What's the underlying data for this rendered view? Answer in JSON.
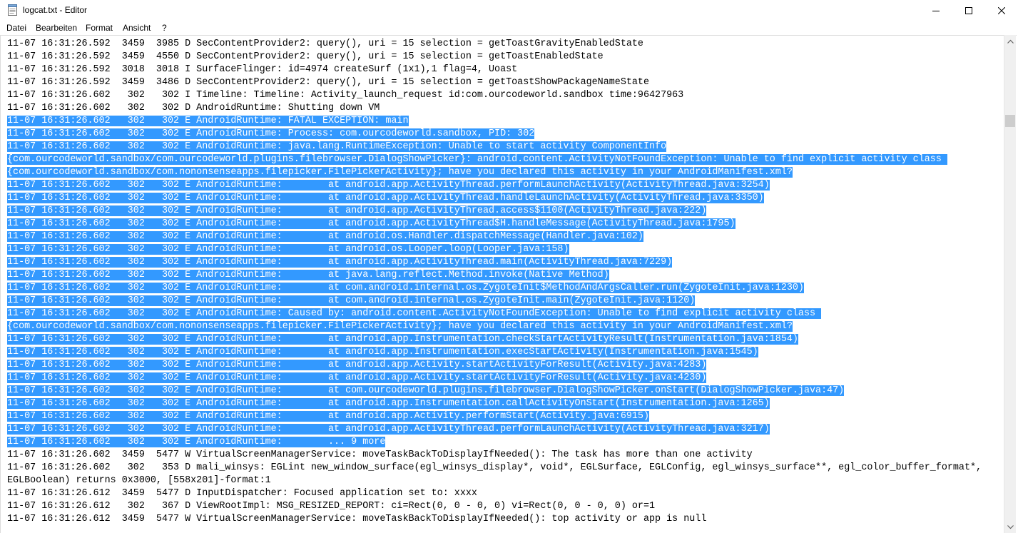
{
  "window": {
    "title": "logcat.txt - Editor",
    "controls": {
      "minimize": "minimize",
      "maximize": "maximize",
      "close": "close"
    }
  },
  "menu": [
    "Datei",
    "Bearbeiten",
    "Format",
    "Ansicht",
    "?"
  ],
  "colors": {
    "selection": "#3399ff",
    "selection_text": "#ffffff",
    "text": "#000000"
  },
  "lines": [
    {
      "text": "11-07 16:31:26.592  3459  3985 D SecContentProvider2: query(), uri = 15 selection = getToastGravityEnabledState",
      "selected": false
    },
    {
      "text": "11-07 16:31:26.592  3459  4550 D SecContentProvider2: query(), uri = 15 selection = getToastEnabledState",
      "selected": false
    },
    {
      "text": "11-07 16:31:26.592  3018  3018 I SurfaceFlinger: id=4974 createSurf (1x1),1 flag=4, Uoast",
      "selected": false
    },
    {
      "text": "11-07 16:31:26.592  3459  3486 D SecContentProvider2: query(), uri = 15 selection = getToastShowPackageNameState",
      "selected": false
    },
    {
      "text": "11-07 16:31:26.602   302   302 I Timeline: Timeline: Activity_launch_request id:com.ourcodeworld.sandbox time:96427963",
      "selected": false
    },
    {
      "text": "11-07 16:31:26.602   302   302 D AndroidRuntime: Shutting down VM",
      "selected": false
    },
    {
      "text": "11-07 16:31:26.602   302   302 E AndroidRuntime: FATAL EXCEPTION: main",
      "selected": true
    },
    {
      "text": "11-07 16:31:26.602   302   302 E AndroidRuntime: Process: com.ourcodeworld.sandbox, PID: 302",
      "selected": true
    },
    {
      "text": "11-07 16:31:26.602   302   302 E AndroidRuntime: java.lang.RuntimeException: Unable to start activity ComponentInfo",
      "selected": true
    },
    {
      "text": "{com.ourcodeworld.sandbox/com.ourcodeworld.plugins.filebrowser.DialogShowPicker}: android.content.ActivityNotFoundException: Unable to find explicit activity class ",
      "selected": true
    },
    {
      "text": "{com.ourcodeworld.sandbox/com.nononsenseapps.filepicker.FilePickerActivity}; have you declared this activity in your AndroidManifest.xml?",
      "selected": true
    },
    {
      "text": "11-07 16:31:26.602   302   302 E AndroidRuntime:        at android.app.ActivityThread.performLaunchActivity(ActivityThread.java:3254)",
      "selected": true
    },
    {
      "text": "11-07 16:31:26.602   302   302 E AndroidRuntime:        at android.app.ActivityThread.handleLaunchActivity(ActivityThread.java:3350)",
      "selected": true
    },
    {
      "text": "11-07 16:31:26.602   302   302 E AndroidRuntime:        at android.app.ActivityThread.access$1100(ActivityThread.java:222)",
      "selected": true
    },
    {
      "text": "11-07 16:31:26.602   302   302 E AndroidRuntime:        at android.app.ActivityThread$H.handleMessage(ActivityThread.java:1795)",
      "selected": true
    },
    {
      "text": "11-07 16:31:26.602   302   302 E AndroidRuntime:        at android.os.Handler.dispatchMessage(Handler.java:102)",
      "selected": true
    },
    {
      "text": "11-07 16:31:26.602   302   302 E AndroidRuntime:        at android.os.Looper.loop(Looper.java:158)",
      "selected": true
    },
    {
      "text": "11-07 16:31:26.602   302   302 E AndroidRuntime:        at android.app.ActivityThread.main(ActivityThread.java:7229)",
      "selected": true
    },
    {
      "text": "11-07 16:31:26.602   302   302 E AndroidRuntime:        at java.lang.reflect.Method.invoke(Native Method)",
      "selected": true
    },
    {
      "text": "11-07 16:31:26.602   302   302 E AndroidRuntime:        at com.android.internal.os.ZygoteInit$MethodAndArgsCaller.run(ZygoteInit.java:1230)",
      "selected": true
    },
    {
      "text": "11-07 16:31:26.602   302   302 E AndroidRuntime:        at com.android.internal.os.ZygoteInit.main(ZygoteInit.java:1120)",
      "selected": true
    },
    {
      "text": "11-07 16:31:26.602   302   302 E AndroidRuntime: Caused by: android.content.ActivityNotFoundException: Unable to find explicit activity class ",
      "selected": true
    },
    {
      "text": "{com.ourcodeworld.sandbox/com.nononsenseapps.filepicker.FilePickerActivity}; have you declared this activity in your AndroidManifest.xml?",
      "selected": true
    },
    {
      "text": "11-07 16:31:26.602   302   302 E AndroidRuntime:        at android.app.Instrumentation.checkStartActivityResult(Instrumentation.java:1854)",
      "selected": true
    },
    {
      "text": "11-07 16:31:26.602   302   302 E AndroidRuntime:        at android.app.Instrumentation.execStartActivity(Instrumentation.java:1545)",
      "selected": true
    },
    {
      "text": "11-07 16:31:26.602   302   302 E AndroidRuntime:        at android.app.Activity.startActivityForResult(Activity.java:4283)",
      "selected": true
    },
    {
      "text": "11-07 16:31:26.602   302   302 E AndroidRuntime:        at android.app.Activity.startActivityForResult(Activity.java:4230)",
      "selected": true
    },
    {
      "text": "11-07 16:31:26.602   302   302 E AndroidRuntime:        at com.ourcodeworld.plugins.filebrowser.DialogShowPicker.onStart(DialogShowPicker.java:47)",
      "selected": true
    },
    {
      "text": "11-07 16:31:26.602   302   302 E AndroidRuntime:        at android.app.Instrumentation.callActivityOnStart(Instrumentation.java:1265)",
      "selected": true
    },
    {
      "text": "11-07 16:31:26.602   302   302 E AndroidRuntime:        at android.app.Activity.performStart(Activity.java:6915)",
      "selected": true
    },
    {
      "text": "11-07 16:31:26.602   302   302 E AndroidRuntime:        at android.app.ActivityThread.performLaunchActivity(ActivityThread.java:3217)",
      "selected": true
    },
    {
      "text": "11-07 16:31:26.602   302   302 E AndroidRuntime:        ... 9 more",
      "selected": true
    },
    {
      "text": "11-07 16:31:26.602  3459  5477 W VirtualScreenManagerService: moveTaskBackToDisplayIfNeeded(): The task has more than one activity",
      "selected": false
    },
    {
      "text": "11-07 16:31:26.602   302   353 D mali_winsys: EGLint new_window_surface(egl_winsys_display*, void*, EGLSurface, EGLConfig, egl_winsys_surface**, egl_color_buffer_format*,",
      "selected": false
    },
    {
      "text": "EGLBoolean) returns 0x3000, [558x201]-format:1",
      "selected": false
    },
    {
      "text": "11-07 16:31:26.612  3459  5477 D InputDispatcher: Focused application set to: xxxx",
      "selected": false
    },
    {
      "text": "11-07 16:31:26.612   302   367 D ViewRootImpl: MSG_RESIZED_REPORT: ci=Rect(0, 0 - 0, 0) vi=Rect(0, 0 - 0, 0) or=1",
      "selected": false
    },
    {
      "text": "11-07 16:31:26.612  3459  5477 W VirtualScreenManagerService: moveTaskBackToDisplayIfNeeded(): top activity or app is null",
      "selected": false
    }
  ]
}
